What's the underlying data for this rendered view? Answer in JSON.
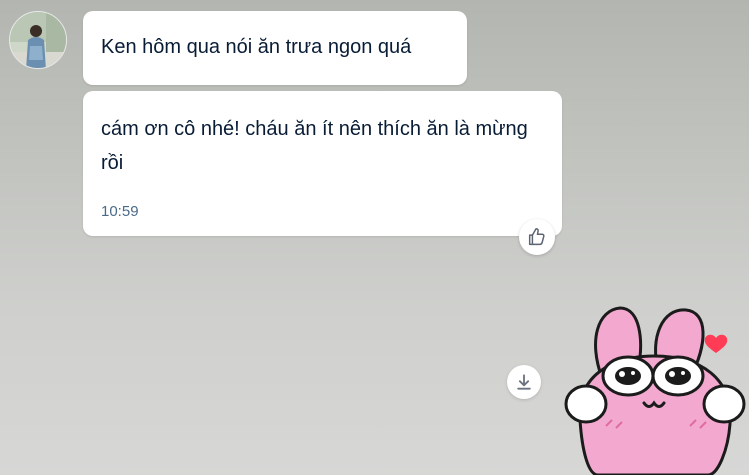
{
  "conversation": {
    "messages": [
      {
        "text": "Ken hôm qua nói ăn trưa ngon quá"
      },
      {
        "text": "cám ơn cô nhé! cháu ăn ít nên thích ăn là mừng rồi",
        "time": "10:59"
      }
    ],
    "reaction_icon": "thumbs-up-icon",
    "download_icon": "download-icon",
    "sticker": {
      "icon": "pink-bunny-sticker"
    }
  },
  "colors": {
    "bubble": "#ffffff",
    "text": "#081c36",
    "timestamp": "#4a6a8a",
    "sticker_pink": "#f3a9cf",
    "heart": "#ff3b56"
  }
}
